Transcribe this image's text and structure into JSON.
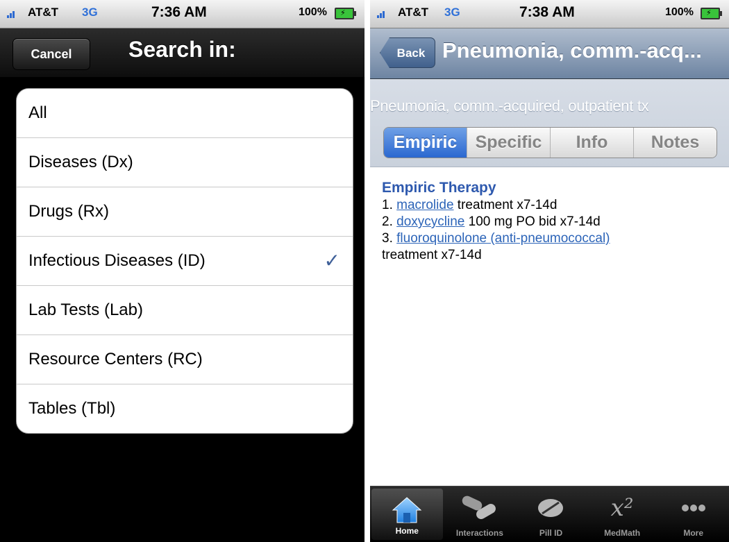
{
  "left_screen": {
    "status_bar": {
      "carrier": "AT&T",
      "network": "3G",
      "time": "7:36 AM",
      "battery": "100%"
    },
    "nav": {
      "cancel_label": "Cancel",
      "title": "Search in:"
    },
    "list_items": [
      {
        "label": "All",
        "checked": false
      },
      {
        "label": "Diseases (Dx)",
        "checked": false
      },
      {
        "label": "Drugs (Rx)",
        "checked": false
      },
      {
        "label": "Infectious Diseases (ID)",
        "checked": true
      },
      {
        "label": "Lab Tests (Lab)",
        "checked": false
      },
      {
        "label": "Resource Centers (RC)",
        "checked": false
      },
      {
        "label": "Tables (Tbl)",
        "checked": false
      }
    ],
    "checkmark_glyph": "✓"
  },
  "right_screen": {
    "status_bar": {
      "carrier": "AT&T",
      "network": "3G",
      "time": "7:38 AM",
      "battery": "100%"
    },
    "nav": {
      "back_label": "Back",
      "title": "Pneumonia, comm.-acq..."
    },
    "subheader_title": "Pneumonia, comm.-acquired, outpatient tx",
    "segments": [
      {
        "label": "Empiric",
        "selected": true
      },
      {
        "label": "Specific",
        "selected": false
      },
      {
        "label": "Info",
        "selected": false
      },
      {
        "label": "Notes",
        "selected": false
      }
    ],
    "content": {
      "heading": "Empiric Therapy",
      "line1_num": "1.",
      "line1_link": "macrolide",
      "line1_text": "treatment x7-14d",
      "line2_num": "2.",
      "line2_link": "doxycycline",
      "line2_text": "100 mg PO bid x7-14d",
      "line3_num": "3.",
      "line3_link": "fluoroquinolone (anti-pneumococcal)",
      "line4_text": "treatment x7-14d"
    },
    "tabs": [
      {
        "label": "Home",
        "icon": "home-icon",
        "selected": true
      },
      {
        "label": "Interactions",
        "icon": "interactions-icon",
        "selected": false
      },
      {
        "label": "Pill ID",
        "icon": "pill-icon",
        "selected": false
      },
      {
        "label": "MedMath",
        "icon": "x-squared-icon",
        "selected": false,
        "icon_text": "x²"
      },
      {
        "label": "More",
        "icon": "more-icon",
        "selected": false
      }
    ]
  },
  "colors": {
    "accent_blue": "#2b68d0",
    "link_blue": "#2c64b8",
    "check_blue": "#3e5f98",
    "nav_blue": "#6d84a2"
  }
}
